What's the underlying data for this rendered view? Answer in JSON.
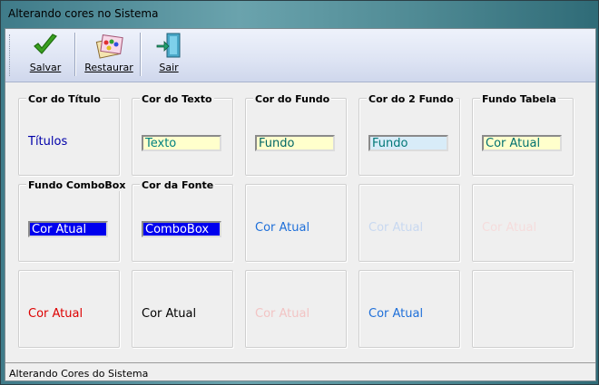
{
  "window": {
    "title": "Alterando cores no Sistema"
  },
  "toolbar": {
    "save": {
      "label": "Salvar",
      "icon": "checkmark-icon"
    },
    "restore": {
      "label": "Restaurar",
      "icon": "palette-icon"
    },
    "exit": {
      "label": "Sair",
      "icon": "door-exit-icon"
    }
  },
  "groups": [
    {
      "title": "Cor do Título",
      "sample": "Títulos",
      "type": "text",
      "color": "#0000aa"
    },
    {
      "title": "Cor do Texto",
      "sample": "Texto",
      "type": "field",
      "color": "#008080",
      "bg": "#ffffcc"
    },
    {
      "title": "Cor do Fundo",
      "sample": "Fundo",
      "type": "field",
      "color": "#006666",
      "bg": "#ffffcc"
    },
    {
      "title": "Cor do 2 Fundo",
      "sample": "Fundo",
      "type": "field",
      "color": "#007777",
      "bg": "#d8ecf8"
    },
    {
      "title": "Fundo Tabela",
      "sample": "Cor Atual",
      "type": "field",
      "color": "#007070",
      "bg": "#ffffcc"
    },
    {
      "title": "Fundo ComboBox",
      "sample": "Cor Atual",
      "type": "field",
      "color": "#ffffff",
      "bg": "#0000ee"
    },
    {
      "title": "Cor da Fonte",
      "sample": "ComboBox",
      "type": "field",
      "color": "#ffffff",
      "bg": "#0000ee"
    },
    {
      "title": "",
      "sample": "Cor Atual",
      "type": "text",
      "color": "#1e6fd9"
    },
    {
      "title": "",
      "sample": "Cor Atual",
      "type": "text",
      "color": "#c8d8f0"
    },
    {
      "title": "",
      "sample": "Cor Atual",
      "type": "text",
      "color": "#f5dcdc"
    },
    {
      "title": "",
      "sample": "Cor Atual",
      "type": "text",
      "color": "#dd0000"
    },
    {
      "title": "",
      "sample": "Cor Atual",
      "type": "text",
      "color": "#000000"
    },
    {
      "title": "",
      "sample": "Cor Atual",
      "type": "text",
      "color": "#f2c4c4"
    },
    {
      "title": "",
      "sample": "Cor Atual",
      "type": "text",
      "color": "#1e6fd9"
    },
    {
      "title": "",
      "sample": "",
      "type": "empty",
      "color": "#000000"
    }
  ],
  "status": {
    "text": "Alterando Cores do Sistema"
  }
}
